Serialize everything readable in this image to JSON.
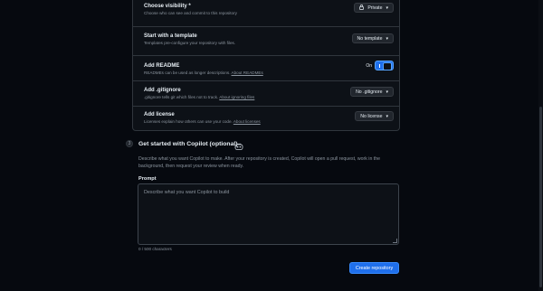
{
  "visibility": {
    "title": "Choose visibility *",
    "desc": "Choose who can see and commit to this repository",
    "value": "Private"
  },
  "template": {
    "title": "Start with a template",
    "desc": "Templates pre-configure your repository with files.",
    "value": "No template"
  },
  "readme": {
    "title": "Add README",
    "desc": "READMEs can be used as longer descriptions.",
    "link": "About READMEs",
    "toggle_label": "On",
    "enabled": true
  },
  "gitignore": {
    "title": "Add .gitignore",
    "desc": ".gitignore tells git which files not to track.",
    "link": "About ignoring files",
    "value": "No .gitignore"
  },
  "license": {
    "title": "Add license",
    "desc": "Licenses explain how others can use your code.",
    "link": "About licenses",
    "value": "No license"
  },
  "copilot": {
    "step": "3",
    "title": "Get started with Copilot (optional)",
    "desc": "Describe what you want Copilot to make. After your repository is created, Copilot will open a pull request, work in the background, then request your review when ready.",
    "prompt_label": "Prompt",
    "prompt_placeholder": "Describe what you want Copilot to build",
    "char_count": "0 / 500 characters"
  },
  "create_button": "Create repository",
  "icons": {
    "lock": "lock-icon",
    "chevron": "chevron-down-icon",
    "copilot": "copilot-icon"
  },
  "colors": {
    "background": "#06090f",
    "accent": "#1f6feb",
    "border": "#30363d",
    "muted_text": "#8b949e"
  }
}
